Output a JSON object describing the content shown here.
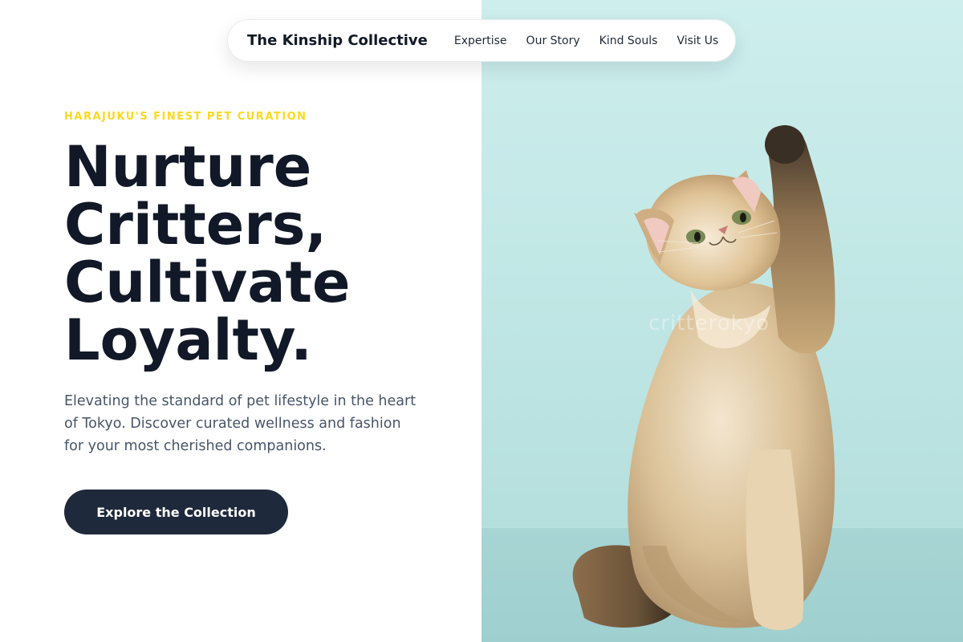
{
  "nav": {
    "brand": "The Kinship Collective",
    "links": [
      "Expertise",
      "Our Story",
      "Kind Souls",
      "Visit Us"
    ]
  },
  "hero": {
    "eyebrow": "HARAJUKU'S FINEST PET CURATION",
    "headline_lines": [
      "Nurture",
      "Critters,",
      "Cultivate",
      "Loyalty."
    ],
    "subtitle": "Elevating the standard of pet lifestyle in the heart of Tokyo. Discover curated wellness and fashion for your most cherished companions.",
    "cta_label": "Explore the Collection"
  },
  "image": {
    "watermark": "critterokyo",
    "subject": "kitten-raising-paw"
  },
  "colors": {
    "accent": "#fcd91f",
    "ink": "#111827",
    "button": "#1e293b",
    "panel_bg": "#c2e8e6"
  }
}
